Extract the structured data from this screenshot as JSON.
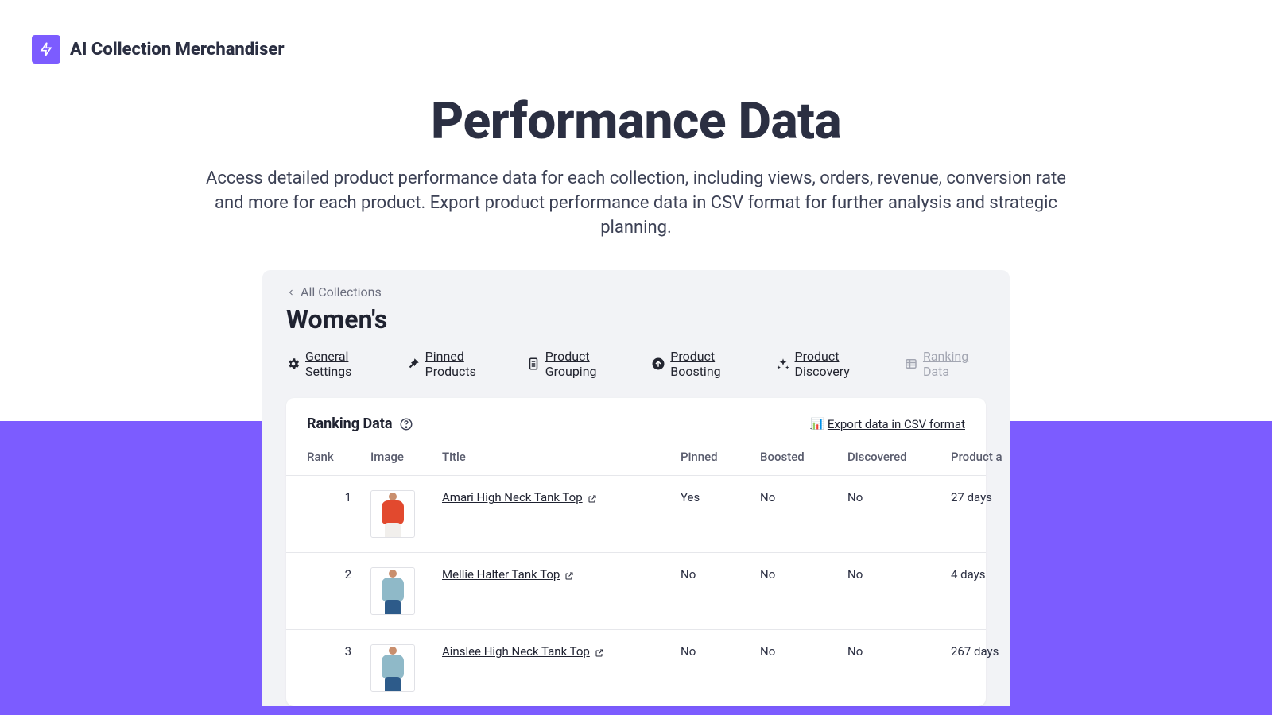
{
  "app": {
    "title": "AI Collection Merchandiser"
  },
  "hero": {
    "heading": "Performance Data",
    "description": "Access detailed product performance data for each collection, including views, orders, revenue, conversion rate and more for each product. Export product performance data in CSV format for further analysis and strategic planning."
  },
  "breadcrumb": {
    "back_label": "All Collections"
  },
  "collection": {
    "name": "Women's"
  },
  "tabs": {
    "general": "General Settings",
    "pinned": "Pinned Products",
    "grouping": "Product Grouping",
    "boosting": "Product Boosting",
    "discovery": "Product Discovery",
    "ranking": "Ranking Data"
  },
  "ranking": {
    "section_title": "Ranking Data",
    "export_label": "Export data in CSV format",
    "columns": {
      "rank": "Rank",
      "image": "Image",
      "title": "Title",
      "pinned": "Pinned",
      "boosted": "Boosted",
      "discovered": "Discovered",
      "product_age": "Product a"
    },
    "rows": [
      {
        "rank": "1",
        "title": "Amari High Neck Tank Top",
        "pinned": "Yes",
        "boosted": "No",
        "discovered": "No",
        "age": "27 days"
      },
      {
        "rank": "2",
        "title": "Mellie Halter Tank Top",
        "pinned": "No",
        "boosted": "No",
        "discovered": "No",
        "age": "4 days"
      },
      {
        "rank": "3",
        "title": "Ainslee High Neck Tank Top",
        "pinned": "No",
        "boosted": "No",
        "discovered": "No",
        "age": "267 days"
      }
    ]
  }
}
